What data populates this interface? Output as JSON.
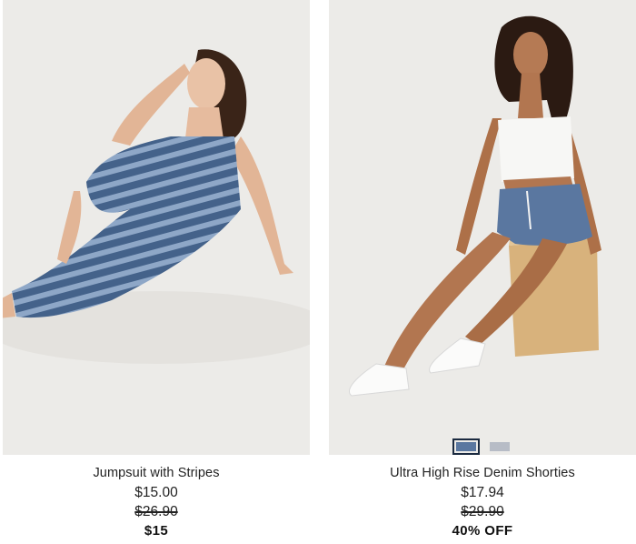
{
  "products": [
    {
      "name": "Jumpsuit with Stripes",
      "price": "$15.00",
      "original_price": "$26.90",
      "promo": "$15",
      "image_alt": "model-in-striped-jumpsuit"
    },
    {
      "name": "Ultra High Rise Denim Shorties",
      "price": "$17.94",
      "original_price": "$29.90",
      "promo": "40% OFF",
      "image_alt": "model-in-denim-shorts",
      "swatches": [
        {
          "color": "#5a77a0",
          "selected": true
        },
        {
          "color": "#b7bcc6",
          "selected": false
        }
      ]
    }
  ],
  "colors": {
    "background": "#ffffff",
    "photo_background": "#ecebe8",
    "text": "#222222",
    "swatch_border": "#1b2a40"
  }
}
